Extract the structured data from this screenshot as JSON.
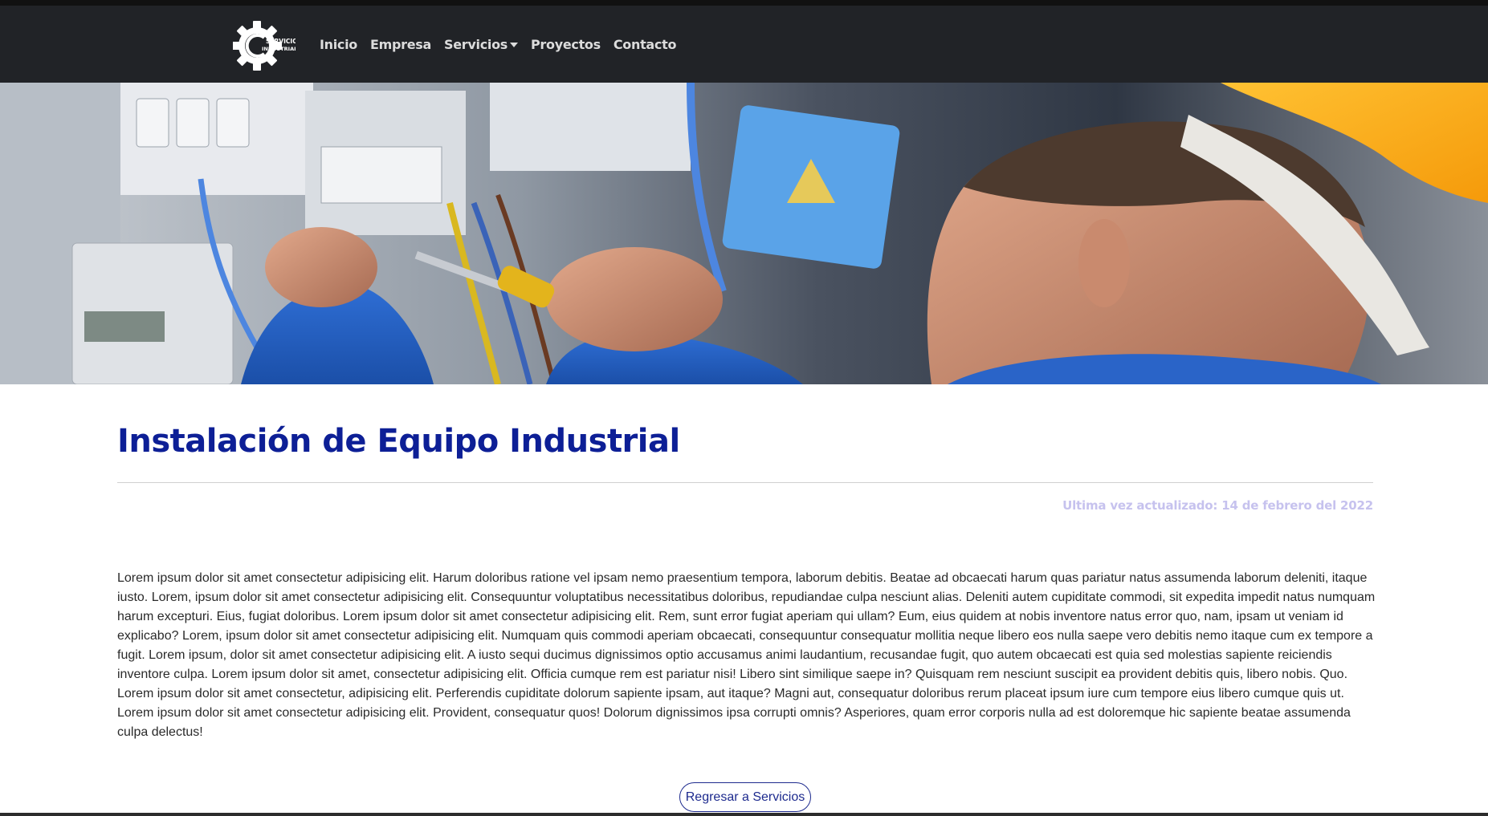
{
  "brand": {
    "logo_text_line1": "SERVICIOS",
    "logo_text_line2": "INDUSTRIALES",
    "logo_icon": "gear-icon"
  },
  "nav": {
    "items": [
      {
        "label": "Inicio"
      },
      {
        "label": "Empresa"
      },
      {
        "label": "Servicios",
        "dropdown": true
      },
      {
        "label": "Proyectos"
      },
      {
        "label": "Contacto"
      }
    ]
  },
  "colors": {
    "navbar_bg": "#212327",
    "title": "#0d1f96",
    "updated_text": "#c6c2ee",
    "button_border": "#1d2a8e"
  },
  "page": {
    "title": "Instalación de Equipo Industrial",
    "updated": "Ultima vez actualizado: 14 de febrero del 2022",
    "body": "Lorem ipsum dolor sit amet consectetur adipisicing elit. Harum doloribus ratione vel ipsam nemo praesentium tempora, laborum debitis. Beatae ad obcaecati harum quas pariatur natus assumenda laborum deleniti, itaque iusto. Lorem, ipsum dolor sit amet consectetur adipisicing elit. Consequuntur voluptatibus necessitatibus doloribus, repudiandae culpa nesciunt alias. Deleniti autem cupiditate commodi, sit expedita impedit natus numquam harum excepturi. Eius, fugiat doloribus. Lorem ipsum dolor sit amet consectetur adipisicing elit. Rem, sunt error fugiat aperiam qui ullam? Eum, eius quidem at nobis inventore natus error quo, nam, ipsam ut veniam id explicabo? Lorem, ipsum dolor sit amet consectetur adipisicing elit. Numquam quis commodi aperiam obcaecati, consequuntur consequatur mollitia neque libero eos nulla saepe vero debitis nemo itaque cum ex tempore a fugit. Lorem ipsum, dolor sit amet consectetur adipisicing elit. A iusto sequi ducimus dignissimos optio accusamus animi laudantium, recusandae fugit, quo autem obcaecati est quia sed molestias sapiente reiciendis inventore culpa. Lorem ipsum dolor sit amet, consectetur adipisicing elit. Officia cumque rem est pariatur nisi! Libero sint similique saepe in? Quisquam rem nesciunt suscipit ea provident debitis quis, libero nobis. Quo. Lorem ipsum dolor sit amet consectetur, adipisicing elit. Perferendis cupiditate dolorum sapiente ipsam, aut itaque? Magni aut, consequatur doloribus rerum placeat ipsum iure cum tempore eius libero cumque quis ut. Lorem ipsum dolor sit amet consectetur adipisicing elit. Provident, consequatur quos! Dolorum dignissimos ipsa corrupti omnis? Asperiores, quam error corporis nulla ad est doloremque hic sapiente beatae assumenda culpa delectus!",
    "back_button": "Regresar a Servicios"
  }
}
